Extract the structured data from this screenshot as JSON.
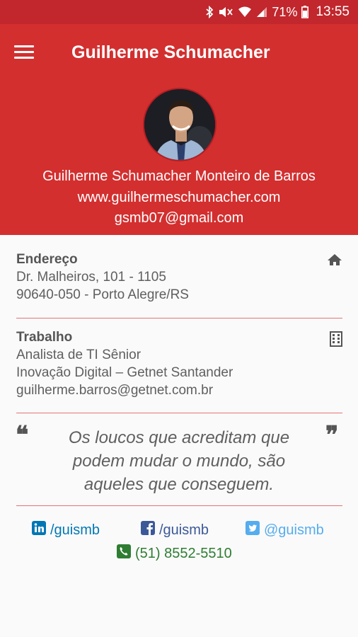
{
  "status_bar": {
    "battery_percent": "71%",
    "time": "13:55"
  },
  "app_bar": {
    "title": "Guilherme Schumacher",
    "menu_icon": "hamburger-menu-icon"
  },
  "profile": {
    "full_name": "Guilherme Schumacher Monteiro de Barros",
    "website": "www.guilhermeschumacher.com",
    "email": "gsmb07@gmail.com"
  },
  "address": {
    "heading": "Endereço",
    "line1": "Dr. Malheiros, 101 - 1105",
    "line2": "90640-050 - Porto Alegre/RS",
    "icon": "home-icon"
  },
  "work": {
    "heading": "Trabalho",
    "role": "Analista de TI Sênior",
    "company": "Inovação Digital – Getnet Santander",
    "email": "guilherme.barros@getnet.com.br",
    "icon": "building-icon"
  },
  "quote": {
    "text": "Os loucos que acreditam que podem mudar o mundo, são aqueles que conseguem.",
    "open_mark": "❝",
    "close_mark": "❞"
  },
  "social": {
    "linkedin": "/guismb",
    "facebook": "/guismb",
    "twitter": "@guismb",
    "phone": "(51) 8552-5510"
  },
  "colors": {
    "primary": "#d32f2f",
    "status_bar": "#c1272d",
    "divider": "#e57373",
    "linkedin": "#0077b5",
    "facebook": "#3b5998",
    "twitter": "#55acee",
    "phone": "#2e7d32"
  }
}
